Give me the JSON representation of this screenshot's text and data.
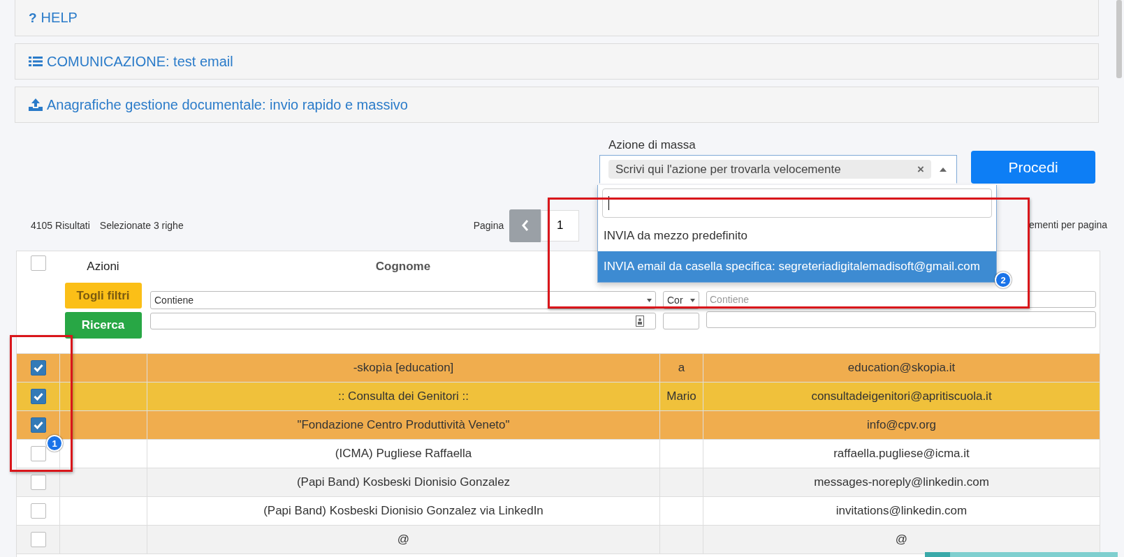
{
  "panels": [
    {
      "kind": "text-icon",
      "mark": "?",
      "title": "HELP"
    },
    {
      "kind": "list",
      "title": "COMUNICAZIONE: test email"
    },
    {
      "kind": "upload",
      "title": "Anagrafiche gestione documentale: invio rapido e massivo"
    }
  ],
  "mass_action": {
    "label": "Azione di massa",
    "value": "Scrivi qui l'azione per trovarla velocemente",
    "clear": "×",
    "expanded": true,
    "options": [
      {
        "label": "INVIA da mezzo predefinito",
        "selected": false
      },
      {
        "label": "INVIA email da casella specifica: segreteriadigitalemadisoft@gmail.com",
        "selected": true
      }
    ],
    "button": "Procedi"
  },
  "summary": {
    "results": "4105 Risultati",
    "selected": "Selezionate 3 righe"
  },
  "pagination": {
    "label": "Pagina",
    "prev_disabled": true,
    "page": "1",
    "per_page_label": "ementi per pagina"
  },
  "table": {
    "select_all_checked": false,
    "columns": [
      {
        "kind": "actions",
        "label": "Azioni"
      },
      {
        "kind": "text",
        "label": "Cognome"
      },
      {
        "kind": "text"
      },
      {
        "kind": "text"
      }
    ],
    "clear_button": "Togli filtri",
    "search_button": "Ricerca",
    "filters": [
      {
        "kind": "select",
        "mode": "Contiene"
      },
      {
        "kind": "select",
        "mode": "Cor"
      },
      {
        "kind": "input",
        "placeholder": "Contiene"
      }
    ],
    "rows": [
      {
        "checked": true,
        "color": "#f0ad4e",
        "cells": [
          "",
          "-skopìa [education]",
          "a",
          "education@skopia.it"
        ]
      },
      {
        "checked": true,
        "color": "#f0c13b",
        "cells": [
          "",
          ":: Consulta dei Genitori ::",
          "Mario",
          "consultadeigenitori@apritiscuola.it"
        ]
      },
      {
        "checked": true,
        "color": "#f0ad4e",
        "cells": [
          "",
          "\"Fondazione Centro Produttività Veneto\"",
          "",
          "info@cpv.org"
        ]
      },
      {
        "checked": false,
        "color": "#ffffff",
        "cells": [
          "",
          "(ICMA) Pugliese Raffaella",
          "",
          "raffaella.pugliese@icma.it"
        ]
      },
      {
        "checked": false,
        "color": "#f2f2f2",
        "cells": [
          "",
          "(Papi Band) Kosbeski Dionisio Gonzalez",
          "",
          "messages-noreply@linkedin.com"
        ]
      },
      {
        "checked": false,
        "color": "#ffffff",
        "cells": [
          "",
          "(Papi Band) Kosbeski Dionisio Gonzalez via LinkedIn",
          "",
          "invitations@linkedin.com"
        ]
      },
      {
        "checked": false,
        "color": "#f2f2f2",
        "cells": [
          "",
          "@",
          "",
          "@"
        ]
      }
    ]
  },
  "annotations": [
    {
      "number": "1"
    },
    {
      "number": "2"
    }
  ]
}
